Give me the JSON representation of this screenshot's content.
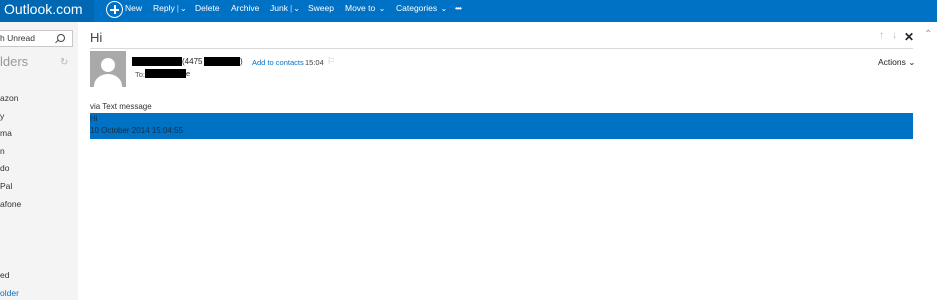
{
  "app": {
    "brand": "Outlook.com"
  },
  "toolbar": {
    "new": "New",
    "reply": "Reply",
    "delete": "Delete",
    "archive": "Archive",
    "junk": "Junk",
    "sweep": "Sweep",
    "move_to": "Move to",
    "categories": "Categories",
    "more": "•••"
  },
  "left_pane": {
    "search_placeholder": "h Unread",
    "folders_heading": "lders",
    "folders": [
      {
        "label": "azon"
      },
      {
        "label": "y"
      },
      {
        "label": "ma"
      },
      {
        "label": "n"
      },
      {
        "label": "do"
      },
      {
        "label": "Pal"
      },
      {
        "label": "afone"
      }
    ],
    "folders_lower": [
      {
        "label": "ed"
      },
      {
        "label": "older"
      }
    ]
  },
  "message": {
    "subject": "Hi",
    "sender_number_prefix": "(4475",
    "sender_close_paren": ")",
    "add_to_contacts": "Add to contacts",
    "time": "15:04",
    "to_label": "To:",
    "recipient_tail": "e",
    "actions": "Actions",
    "via": "via Text message",
    "body_line1": "Hi",
    "body_line2": "10 October 2014 15:04:55"
  },
  "icons": {
    "new": "plus-circle-icon",
    "search": "search-icon",
    "refresh": "refresh-icon",
    "prev": "arrow-up-icon",
    "next": "arrow-down-icon",
    "close": "close-icon",
    "flag": "flag-icon",
    "scroll_up": "chevron-up-icon"
  },
  "colors": {
    "brand_blue": "#0072c6",
    "brand_dark": "#0067b3",
    "selection": "#0072c6"
  }
}
